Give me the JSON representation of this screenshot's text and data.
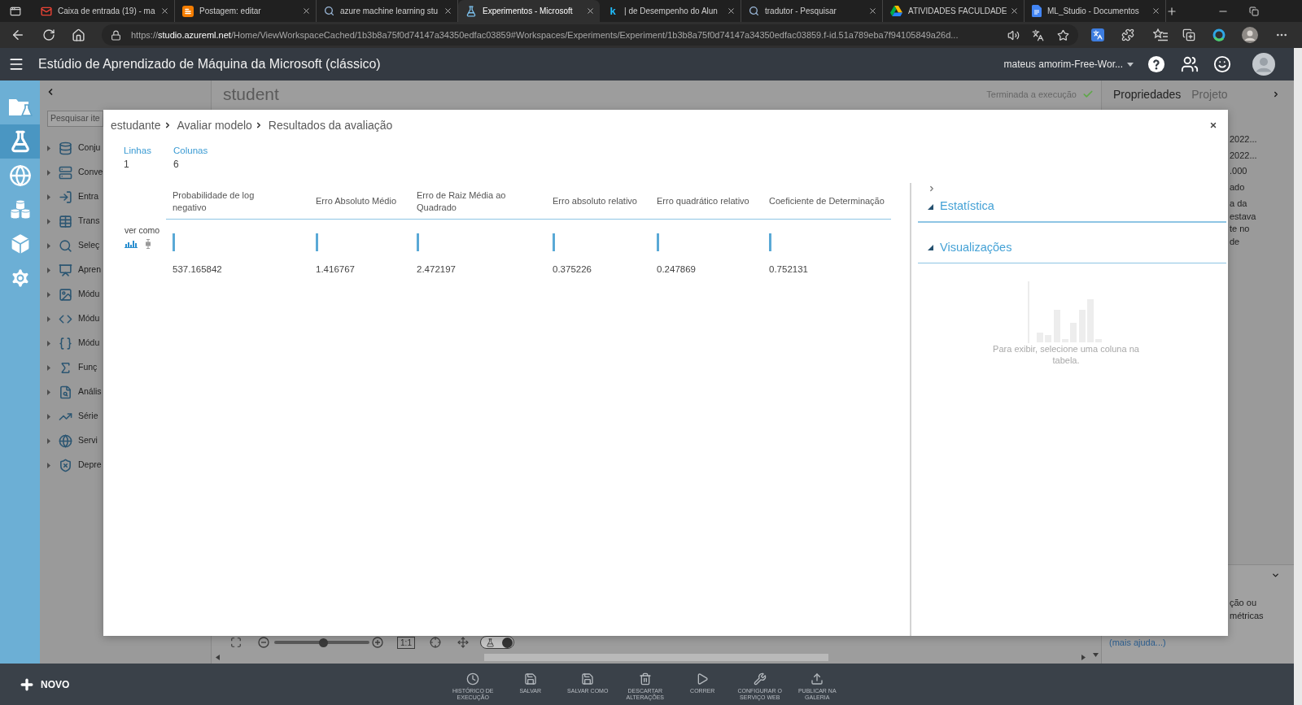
{
  "browser": {
    "tabs": [
      {
        "kind": "mail",
        "title": "Caixa de entrada (19) - ma",
        "selected": false
      },
      {
        "kind": "blog",
        "title": "Postagem: editar",
        "selected": false
      },
      {
        "kind": "search",
        "title": "azure machine learning stu",
        "selected": false
      },
      {
        "kind": "flask",
        "title": "Experimentos - Microsoft",
        "selected": true
      },
      {
        "kind": "letter",
        "icon_text": "k",
        "title": "| de Desempenho do Alun",
        "selected": false
      },
      {
        "kind": "search",
        "title": "tradutor - Pesquisar",
        "selected": false
      },
      {
        "kind": "drive",
        "title": "ATIVIDADES FACULDADE",
        "selected": false
      },
      {
        "kind": "docs",
        "title": "ML_Studio - Documentos",
        "selected": false
      }
    ],
    "address": {
      "scheme": "https://",
      "host": "studio.azureml.net",
      "path": "/Home/ViewWorkspaceCached/1b3b8a75f0d74147a34350edfac03859#Workspaces/Experiments/Experiment/1b3b8a75f0d74147a34350edfac03859.f-id.51a789eba7f94105849a26d..."
    }
  },
  "app_header": {
    "title": "Estúdio de Aprendizado de Máquina da Microsoft (clássico)",
    "user": "mateus amorim-Free-Wor..."
  },
  "nav": [
    {
      "kind": "projects",
      "selected": false
    },
    {
      "kind": "experiments",
      "selected": true
    },
    {
      "kind": "web_services",
      "selected": false
    },
    {
      "kind": "datasets",
      "selected": false
    },
    {
      "kind": "trained_models",
      "selected": false
    },
    {
      "kind": "settings",
      "selected": false
    }
  ],
  "palette": {
    "search": {
      "placeholder": "Pesquisar ite"
    },
    "items": [
      {
        "kind": "datasets",
        "label": "Conju",
        "expanded": false
      },
      {
        "kind": "data_format",
        "label": "Conve",
        "expanded": false
      },
      {
        "kind": "data_io",
        "label": "Entra",
        "expanded": false
      },
      {
        "kind": "transform",
        "label": "Trans",
        "expanded": false
      },
      {
        "kind": "feature_selection",
        "label": "Seleç",
        "expanded": false
      },
      {
        "kind": "ml",
        "label": "Apren",
        "expanded": false
      },
      {
        "kind": "opencv",
        "label": "Módu",
        "expanded": false
      },
      {
        "kind": "python",
        "label": "Módu",
        "expanded": false
      },
      {
        "kind": "r",
        "label": "Módu",
        "expanded": false
      },
      {
        "kind": "stats",
        "label": "Funç",
        "expanded": false
      },
      {
        "kind": "text",
        "label": "Anális",
        "expanded": false
      },
      {
        "kind": "time_series",
        "label": "Série",
        "expanded": false
      },
      {
        "kind": "web_service",
        "label": "Servi",
        "expanded": false
      },
      {
        "kind": "deprecated",
        "label": "Depre",
        "expanded": false
      }
    ]
  },
  "canvas": {
    "title": "student",
    "status": "Terminada a execução",
    "zoom": {
      "level": 0.52
    },
    "actual_size": "1:1",
    "toggle_on": true
  },
  "properties": {
    "tabs": [
      {
        "label": "Propriedades",
        "selected": true
      },
      {
        "label": "Projeto",
        "selected": false
      }
    ],
    "values": [
      "2022...",
      "2022...",
      ".000",
      "ado"
    ],
    "description": [
      "a da",
      "estava",
      "te no",
      "de"
    ],
    "help": [
      "ção ou",
      "métricas"
    ],
    "help_link": "(mais ajuda...)"
  },
  "modal": {
    "breadcrumb": [
      "estudante",
      "Avaliar modelo",
      "Resultados da avaliação"
    ],
    "summary": [
      {
        "label": "Linhas",
        "value": "1"
      },
      {
        "label": "Colunas",
        "value": "6"
      }
    ],
    "view_label": "ver como",
    "view_modes": [
      {
        "kind": "histogram",
        "selected": true
      },
      {
        "kind": "boxplot",
        "selected": false
      }
    ],
    "columns": [
      "Probabilidade de log negativo",
      "Erro Absoluto Médio",
      "Erro de Raiz Média ao Quadrado",
      "Erro absoluto relativo",
      "Erro quadrático relativo",
      "Coeficiente de Determinação"
    ],
    "rows": [
      [
        "537.165842",
        "1.416767",
        "2.472197",
        "0.375226",
        "0.247869",
        "0.752131"
      ]
    ],
    "sections": [
      {
        "title": "Estatística",
        "expanded": true
      },
      {
        "title": "Visualizações",
        "expanded": true
      }
    ],
    "visualization_hint": "Para exibir, selecione uma coluna na tabela."
  },
  "toolbar": {
    "new": "NOVO",
    "buttons": [
      {
        "kind": "history",
        "label": "HISTÓRICO DE EXECUÇÃO"
      },
      {
        "kind": "save",
        "label": "SALVAR"
      },
      {
        "kind": "save_as",
        "label": "SALVAR COMO"
      },
      {
        "kind": "discard",
        "label": "DESCARTAR ALTERAÇÕES"
      },
      {
        "kind": "run",
        "label": "CORRER"
      },
      {
        "kind": "web_service",
        "label": "CONFIGURAR O SERVIÇO WEB"
      },
      {
        "kind": "publish",
        "label": "PUBLICAR NA GALERIA"
      }
    ]
  }
}
